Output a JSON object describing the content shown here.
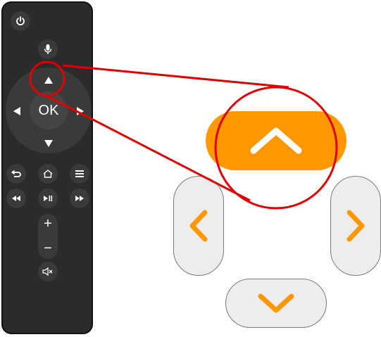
{
  "remote": {
    "ok_label": "OK",
    "volume_up_label": "+",
    "volume_down_label": "−",
    "buttons": [
      "power",
      "microphone",
      "up",
      "left",
      "right",
      "down",
      "back",
      "home",
      "menu",
      "rewind",
      "play-pause",
      "fast-forward",
      "mute"
    ]
  },
  "zoomed_dpad": {
    "buttons": [
      "up",
      "left",
      "right",
      "down"
    ],
    "highlighted": "up"
  },
  "colors": {
    "remote_body": "#2b2b2b",
    "remote_button": "#3a3a3a",
    "accent": "#ff9800",
    "highlight_ring": "#e00000",
    "zoom_button": "#ededed"
  }
}
